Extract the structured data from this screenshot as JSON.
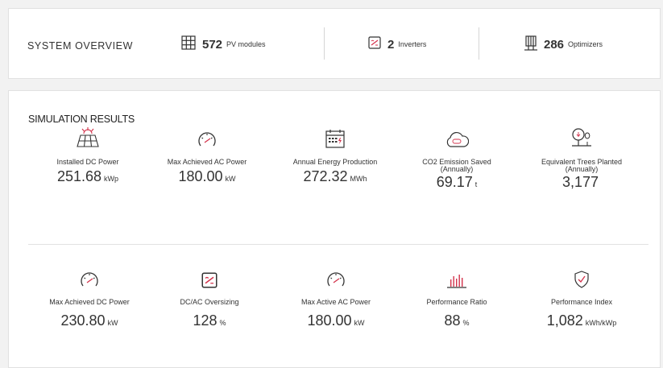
{
  "overview": {
    "title": "SYSTEM OVERVIEW",
    "items": [
      {
        "icon": "solar-panel-grid-icon",
        "value": "572",
        "label": "PV modules"
      },
      {
        "icon": "inverter-icon",
        "value": "2",
        "label": "Inverters"
      },
      {
        "icon": "optimizer-icon",
        "value": "286",
        "label": "Optimizers"
      }
    ]
  },
  "simulation": {
    "title": "SIMULATION RESULTS",
    "row1": [
      {
        "icon": "solar-panel-sun-icon",
        "label": "Installed DC Power",
        "sub": "",
        "value": "251.68",
        "unit": "kWp"
      },
      {
        "icon": "gauge-icon",
        "label": "Max Achieved AC Power",
        "sub": "",
        "value": "180.00",
        "unit": "kW"
      },
      {
        "icon": "calendar-icon",
        "label": "Annual Energy Production",
        "sub": "",
        "value": "272.32",
        "unit": "MWh"
      },
      {
        "icon": "co2-cloud-icon",
        "label": "CO2 Emission Saved",
        "sub": "(Annually)",
        "value": "69.17",
        "unit": "t"
      },
      {
        "icon": "tree-icon",
        "label": "Equivalent Trees Planted",
        "sub": "(Annually)",
        "value": "3,177",
        "unit": ""
      }
    ],
    "row2": [
      {
        "icon": "gauge-icon",
        "label": "Max Achieved DC Power",
        "value": "230.80",
        "unit": "kW"
      },
      {
        "icon": "inverter-icon",
        "label": "DC/AC Oversizing",
        "value": "128",
        "unit": "%"
      },
      {
        "icon": "gauge-icon",
        "label": "Max Active AC Power",
        "value": "180.00",
        "unit": "kW"
      },
      {
        "icon": "bar-chart-icon",
        "label": "Performance Ratio",
        "value": "88",
        "unit": "%"
      },
      {
        "icon": "shield-check-icon",
        "label": "Performance Index",
        "value": "1,082",
        "unit": "kWh/kWp"
      }
    ]
  },
  "colors": {
    "accent": "#d3324b",
    "text": "#333333",
    "border": "#e1e1e1"
  }
}
